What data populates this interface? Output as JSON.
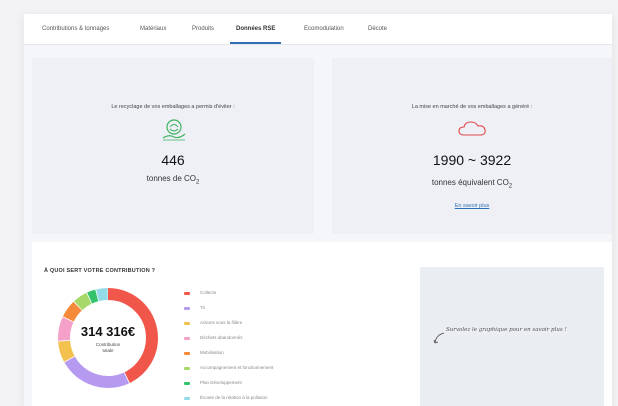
{
  "tabs": [
    {
      "label": "Contributions & tonnages",
      "active": false
    },
    {
      "label": "Matériaux",
      "active": false
    },
    {
      "label": "Produits",
      "active": false
    },
    {
      "label": "Données RSE",
      "active": true
    },
    {
      "label": "Ecomodulation",
      "active": false
    },
    {
      "label": "Décote",
      "active": false
    }
  ],
  "recycling": {
    "title": "Le recyclage de vos emballages a permis d'éviter :",
    "value": "446",
    "unit": "tonnes de CO",
    "unit_sub": "2",
    "icon": "recycle-hand-icon",
    "icon_color": "#3fb35f"
  },
  "market": {
    "title": "La mise en marché de vos emballages a généré :",
    "value": "1990 ~ 3922",
    "unit": "tonnes équivalent CO",
    "unit_sub": "2",
    "link": "En savoir plus",
    "icon": "cloud-icon",
    "icon_color": "#e34b4b"
  },
  "contribution": {
    "title": "À QUOI SERT VOTRE CONTRIBUTION ?",
    "amount": "314 316€",
    "caption_line1": "Contribution",
    "caption_line2": "totale",
    "legend": [
      {
        "label": "Collecte",
        "color": "#f0574a",
        "share": 0.43
      },
      {
        "label": "Tri",
        "color": "#b59af0",
        "share": 0.24
      },
      {
        "label": "Actions sous la filière",
        "color": "#f2c14e",
        "share": 0.07
      },
      {
        "label": "Déchets abandonnés",
        "color": "#f4a0c8",
        "share": 0.08
      },
      {
        "label": "Mobilisation",
        "color": "#f58a3a",
        "share": 0.06
      },
      {
        "label": "Accompagnement et fonctionnement",
        "color": "#a6d96a",
        "share": 0.05
      },
      {
        "label": "Plan Développement",
        "color": "#35c26d",
        "share": 0.03
      },
      {
        "label": "Écoute de la relation à la pollution",
        "color": "#93dbe8",
        "share": 0.04
      }
    ]
  },
  "right_hint": "Survolez le graphique pour en savoir plus !"
}
